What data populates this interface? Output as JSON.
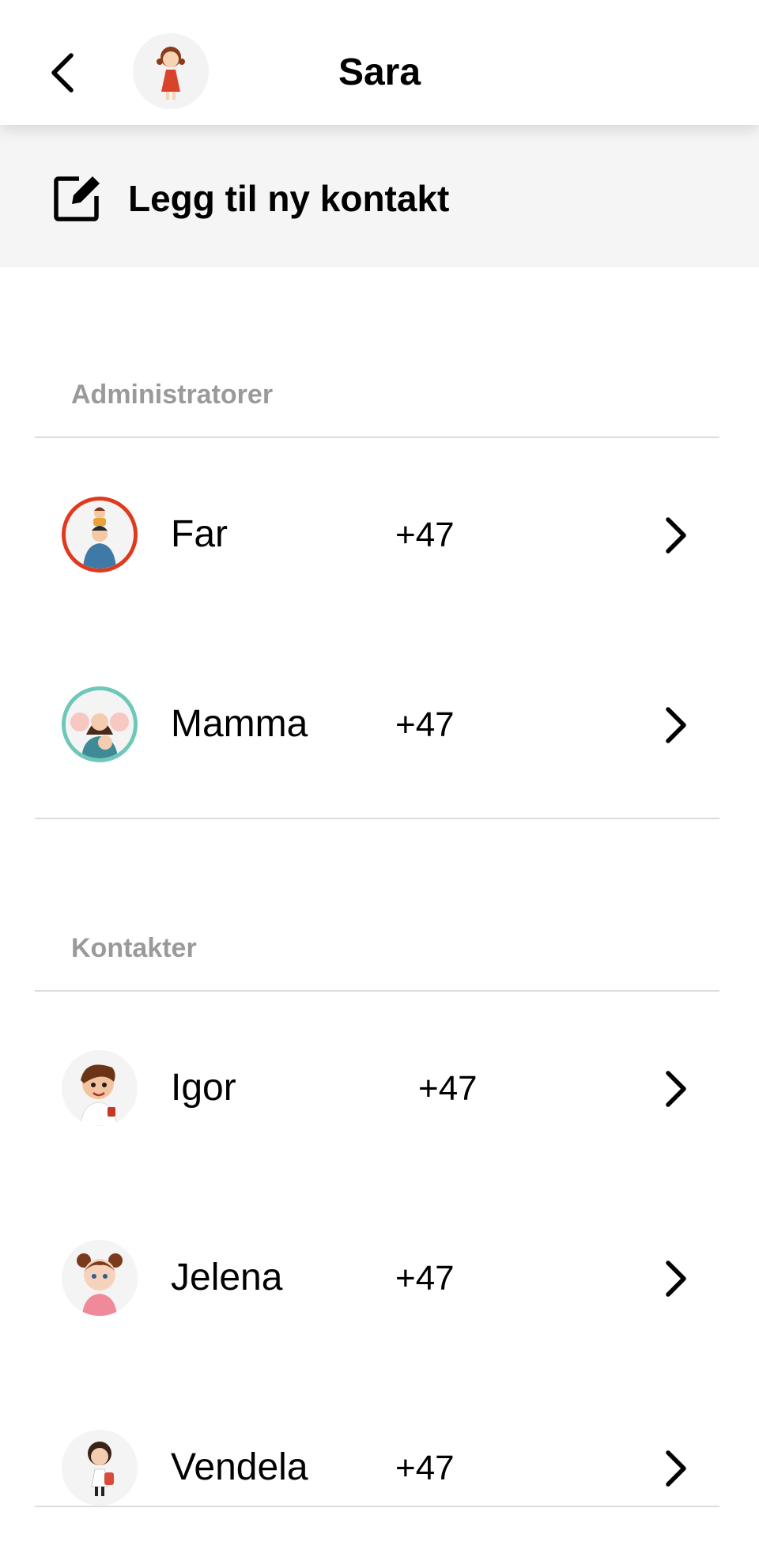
{
  "header": {
    "title": "Sara",
    "back_icon": "chevron-left-icon",
    "avatar": "girl-avatar-image"
  },
  "add_contact": {
    "label": "Legg til ny kontakt",
    "icon": "edit-square-icon"
  },
  "sections": {
    "admins": {
      "title": "Administratorer",
      "rows": [
        {
          "name": "Far",
          "phone": "+47",
          "avatar": "father-avatar",
          "ring_color": "#e03a1e"
        },
        {
          "name": "Mamma",
          "phone": "+47",
          "avatar": "mother-avatar",
          "ring_color": "#6fc7b7"
        }
      ]
    },
    "contacts": {
      "title": "Kontakter",
      "rows": [
        {
          "name": "Igor",
          "phone": "+47",
          "avatar": "boy-avatar"
        },
        {
          "name": "Jelena",
          "phone": "+47",
          "avatar": "girl-pigtails-avatar"
        },
        {
          "name": "Vendela",
          "phone": "+47",
          "avatar": "girl-backpack-avatar"
        }
      ]
    }
  },
  "colors": {
    "accent_red": "#e03a1e",
    "accent_teal": "#6fc7b7",
    "section_text": "#9a9a9a",
    "add_bar_bg": "#f5f5f5"
  }
}
